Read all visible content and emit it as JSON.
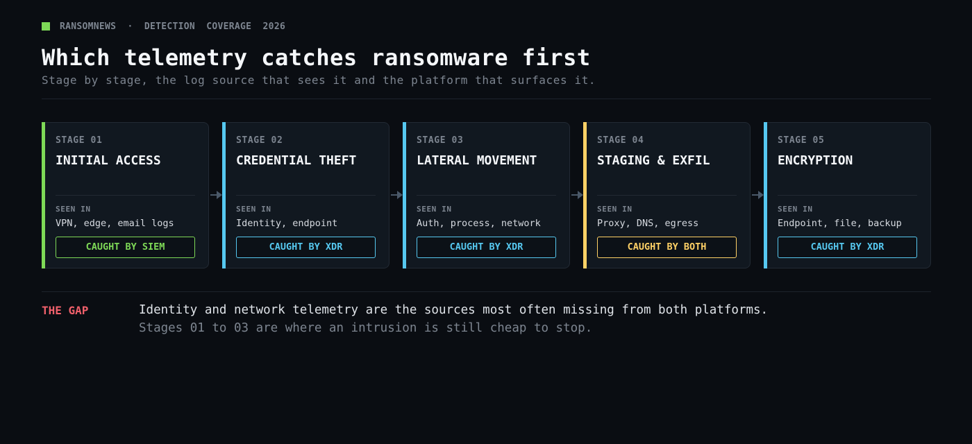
{
  "header": {
    "eyebrow": "RANSOMNEWS  ·  DETECTION  COVERAGE  2026",
    "title": "Which telemetry catches ransomware first",
    "subtitle": "Stage by stage, the log source that sees it and the platform that surfaces it."
  },
  "seen_label": "SEEN IN",
  "stages": [
    {
      "stage": "STAGE 01",
      "name": "INITIAL ACCESS",
      "seen": "VPN, edge, email logs",
      "badge": "CAUGHT BY SIEM",
      "color": "#7ed957"
    },
    {
      "stage": "STAGE 02",
      "name": "CREDENTIAL THEFT",
      "seen": "Identity, endpoint",
      "badge": "CAUGHT BY XDR",
      "color": "#56c8f0"
    },
    {
      "stage": "STAGE 03",
      "name": "LATERAL MOVEMENT",
      "seen": "Auth, process, network",
      "badge": "CAUGHT BY XDR",
      "color": "#56c8f0"
    },
    {
      "stage": "STAGE 04",
      "name": "STAGING & EXFIL",
      "seen": "Proxy, DNS, egress",
      "badge": "CAUGHT BY BOTH",
      "color": "#ffd166"
    },
    {
      "stage": "STAGE 05",
      "name": "ENCRYPTION",
      "seen": "Endpoint, file, backup",
      "badge": "CAUGHT BY XDR",
      "color": "#56c8f0"
    }
  ],
  "gap": {
    "label": "THE GAP",
    "line1": "Identity and network telemetry are the sources most often missing from both platforms.",
    "line2": "Stages 01 to 03 are where an intrusion is still cheap to stop."
  },
  "colors": {
    "accent_green": "#7ed957",
    "accent_cyan": "#56c8f0",
    "accent_yellow": "#ffd166",
    "alert_red": "#f0606b",
    "background": "#0a0d12"
  }
}
